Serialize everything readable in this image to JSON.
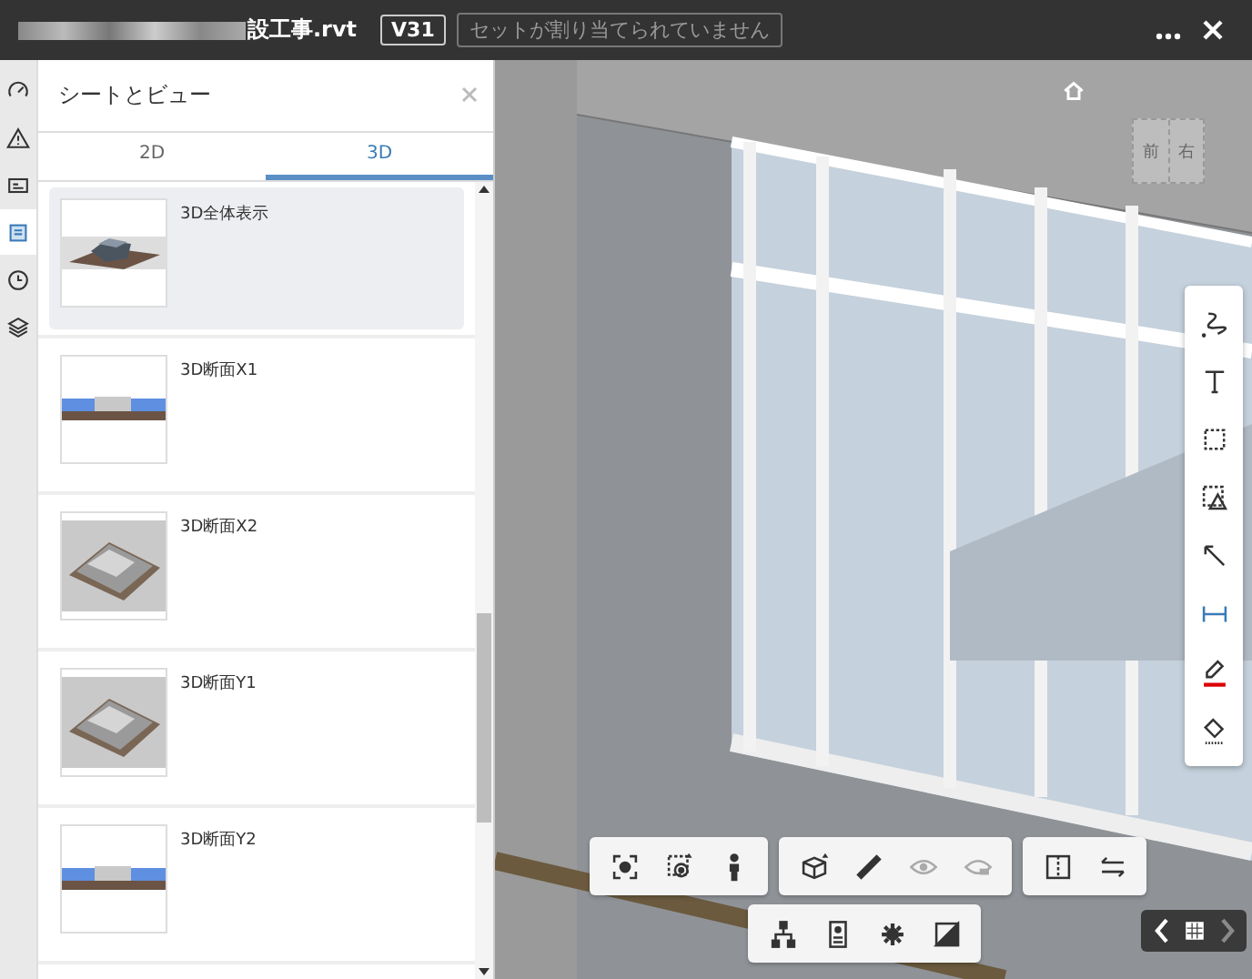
{
  "title_bar": {
    "file_name": "設工事.rvt",
    "version": "V31",
    "set_status": "セットが割り当てられていません"
  },
  "rail_items": [
    {
      "kind": "measure",
      "selected": false
    },
    {
      "kind": "warning",
      "selected": false
    },
    {
      "kind": "card",
      "selected": false
    },
    {
      "kind": "sheets",
      "selected": true
    },
    {
      "kind": "clock",
      "selected": false
    },
    {
      "kind": "layers",
      "selected": false
    }
  ],
  "panel": {
    "title": "シートとビュー",
    "tabs": [
      {
        "label": "2D",
        "selected": false
      },
      {
        "label": "3D",
        "selected": true
      }
    ],
    "views": [
      {
        "name": "3D全体表示",
        "kind": "overall",
        "selected": true
      },
      {
        "name": "3D断面X1",
        "kind": "section",
        "selected": false
      },
      {
        "name": "3D断面X2",
        "kind": "iso",
        "selected": false
      },
      {
        "name": "3D断面Y1",
        "kind": "iso",
        "selected": false
      },
      {
        "name": "3D断面Y2",
        "kind": "section",
        "selected": false
      }
    ]
  },
  "viewcube": {
    "front": "前",
    "right": "右"
  },
  "markup_tools": [
    {
      "kind": "freehand"
    },
    {
      "kind": "text"
    },
    {
      "kind": "rect"
    },
    {
      "kind": "shapes"
    },
    {
      "kind": "arrow"
    },
    {
      "kind": "dimension"
    },
    {
      "kind": "pen"
    },
    {
      "kind": "fill"
    }
  ],
  "toolbar_groups": [
    [
      {
        "kind": "focus"
      },
      {
        "kind": "zoom"
      },
      {
        "kind": "person"
      }
    ],
    [
      {
        "kind": "cube"
      },
      {
        "kind": "ruler"
      },
      {
        "kind": "eye"
      },
      {
        "kind": "eye2"
      }
    ],
    [
      {
        "kind": "split"
      },
      {
        "kind": "swap"
      }
    ],
    [
      {
        "kind": "tree"
      },
      {
        "kind": "props"
      },
      {
        "kind": "gear"
      },
      {
        "kind": "contrast"
      }
    ]
  ],
  "nav": [
    {
      "kind": "prev",
      "disabled": false
    },
    {
      "kind": "grid",
      "disabled": false
    },
    {
      "kind": "next",
      "disabled": true
    }
  ]
}
